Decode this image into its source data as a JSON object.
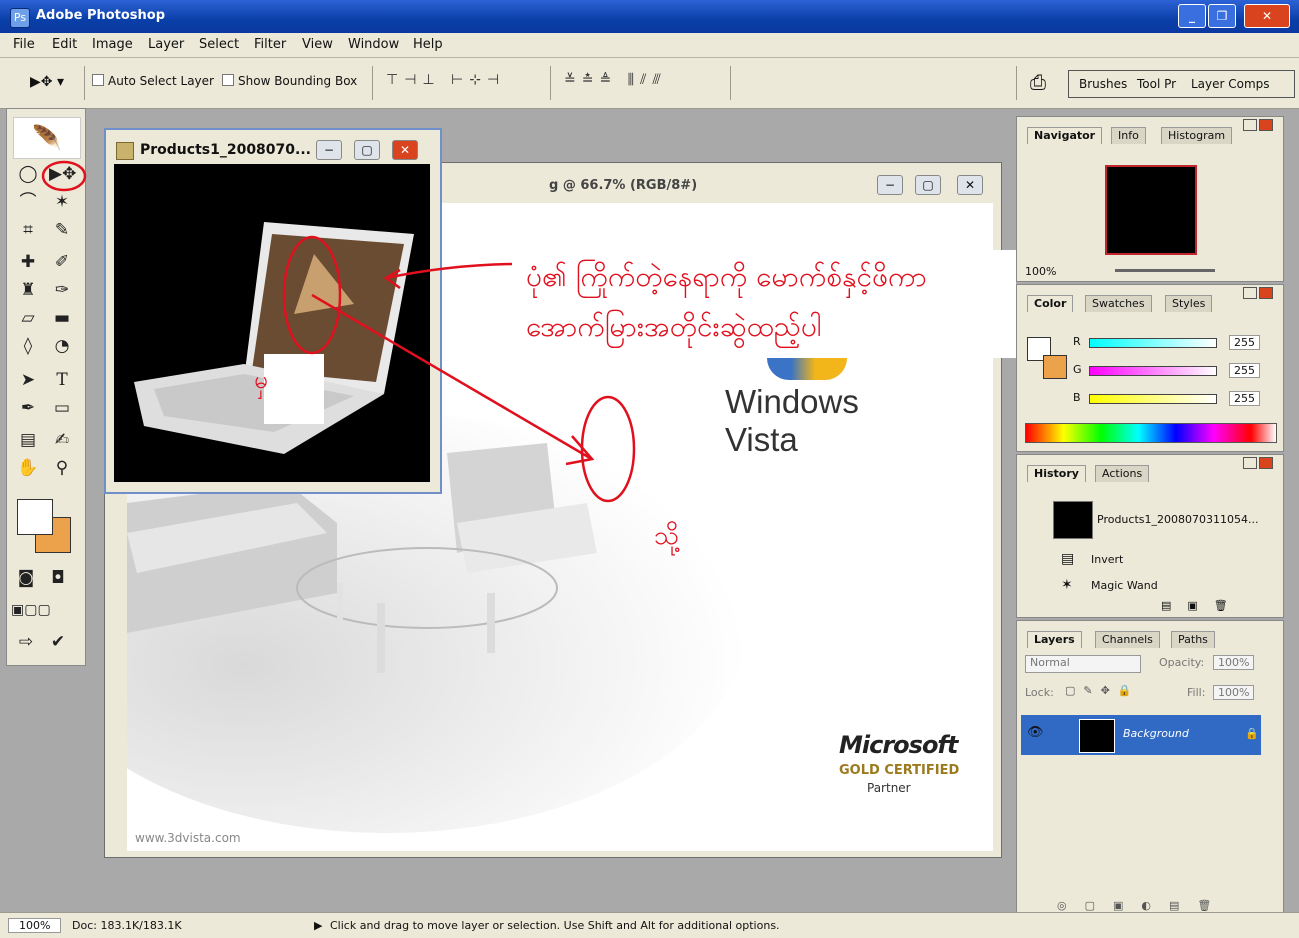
{
  "app": {
    "title": "Adobe Photoshop"
  },
  "menu": [
    "File",
    "Edit",
    "Image",
    "Layer",
    "Select",
    "Filter",
    "View",
    "Window",
    "Help"
  ],
  "options": {
    "auto_select": "Auto Select Layer",
    "bounding_box": "Show Bounding Box"
  },
  "wells": [
    "Brushes",
    "Tool Pr",
    "Layer Comps"
  ],
  "doc1": {
    "title": "Products1_2008070..."
  },
  "doc2": {
    "title": "g @ 66.7% (RGB/8#)",
    "watermark": "www.3dvista.com",
    "brand": "Windows Vista",
    "ms": "Microsoft",
    "gold": "GOLD CERTIFIED",
    "partner": "Partner"
  },
  "annotation": {
    "line1": "ပုံ၏ ကြိုက်တဲ့နေရာကို မောက်စ်နှင့်ဖိကာ",
    "line2": "အောက်မြားအတိုင်းဆွဲထည့်ပါ",
    "from": "မှ",
    "to": "သို့"
  },
  "navigator": {
    "tabs": [
      "Navigator",
      "Info",
      "Histogram"
    ],
    "zoom": "100%"
  },
  "color": {
    "tabs": [
      "Color",
      "Swatches",
      "Styles"
    ],
    "r_label": "R",
    "g_label": "G",
    "b_label": "B",
    "r": "255",
    "g": "255",
    "b": "255"
  },
  "history": {
    "tabs": [
      "History",
      "Actions"
    ],
    "snapshot": "Products1_2008070311054...",
    "items": [
      "Invert",
      "Magic Wand"
    ]
  },
  "layers": {
    "tabs": [
      "Layers",
      "Channels",
      "Paths"
    ],
    "blend": "Normal",
    "opacity_label": "Opacity:",
    "opacity": "100%",
    "lock_label": "Lock:",
    "fill_label": "Fill:",
    "fill": "100%",
    "layer_name": "Background"
  },
  "status": {
    "zoom": "100%",
    "doc": "Doc: 183.1K/183.1K",
    "hint": "Click and drag to move layer or selection.  Use Shift and Alt for additional options."
  }
}
